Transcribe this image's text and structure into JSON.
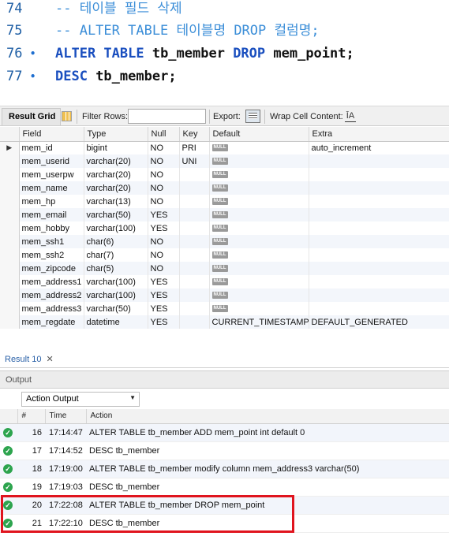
{
  "editor": {
    "lines": [
      {
        "number": "74",
        "dot": "",
        "segments": [
          {
            "cls": "cm",
            "text": "-- 테이블 필드 삭제"
          }
        ]
      },
      {
        "number": "75",
        "dot": "",
        "segments": [
          {
            "cls": "cm",
            "text": "-- ALTER TABLE 테이블명 DROP 컬럼명;"
          }
        ]
      },
      {
        "number": "76",
        "dot": "•",
        "segments": [
          {
            "cls": "kw",
            "text": "ALTER TABLE "
          },
          {
            "cls": "id",
            "text": "tb_member "
          },
          {
            "cls": "kw",
            "text": "DROP "
          },
          {
            "cls": "id",
            "text": "mem_point"
          },
          {
            "cls": "plain",
            "text": ";"
          }
        ]
      },
      {
        "number": "77",
        "dot": "•",
        "segments": [
          {
            "cls": "kw",
            "text": "DESC "
          },
          {
            "cls": "id",
            "text": "tb_member"
          },
          {
            "cls": "plain",
            "text": ";"
          }
        ]
      }
    ]
  },
  "grid_toolbar": {
    "tab_label": "Result Grid",
    "filter_label": "Filter Rows:",
    "export_label": "Export:",
    "wrap_label": "Wrap Cell Content:",
    "wrap_icon": "ĪA"
  },
  "result": {
    "row_marker": "▶",
    "null_text": "NULL",
    "columns": [
      "Field",
      "Type",
      "Null",
      "Key",
      "Default",
      "Extra"
    ],
    "rows": [
      [
        "mem_id",
        "bigint",
        "NO",
        "PRI",
        "NULL",
        "auto_increment"
      ],
      [
        "mem_userid",
        "varchar(20)",
        "NO",
        "UNI",
        "NULL",
        ""
      ],
      [
        "mem_userpw",
        "varchar(20)",
        "NO",
        "",
        "NULL",
        ""
      ],
      [
        "mem_name",
        "varchar(20)",
        "NO",
        "",
        "NULL",
        ""
      ],
      [
        "mem_hp",
        "varchar(13)",
        "NO",
        "",
        "NULL",
        ""
      ],
      [
        "mem_email",
        "varchar(50)",
        "YES",
        "",
        "NULL",
        ""
      ],
      [
        "mem_hobby",
        "varchar(100)",
        "YES",
        "",
        "NULL",
        ""
      ],
      [
        "mem_ssh1",
        "char(6)",
        "NO",
        "",
        "NULL",
        ""
      ],
      [
        "mem_ssh2",
        "char(7)",
        "NO",
        "",
        "NULL",
        ""
      ],
      [
        "mem_zipcode",
        "char(5)",
        "NO",
        "",
        "NULL",
        ""
      ],
      [
        "mem_address1",
        "varchar(100)",
        "YES",
        "",
        "NULL",
        ""
      ],
      [
        "mem_address2",
        "varchar(100)",
        "YES",
        "",
        "NULL",
        ""
      ],
      [
        "mem_address3",
        "varchar(50)",
        "YES",
        "",
        "NULL",
        ""
      ],
      [
        "mem_regdate",
        "datetime",
        "YES",
        "",
        "CURRENT_TIMESTAMP",
        "DEFAULT_GENERATED"
      ]
    ]
  },
  "result_tab": {
    "label": "Result 10",
    "close": "✕"
  },
  "output": {
    "title": "Output",
    "selector_value": "Action Output",
    "selector_arrow": "▼",
    "columns": [
      "#",
      "Time",
      "Action"
    ],
    "status_glyph": "✓",
    "rows": [
      {
        "num": "16",
        "time": "17:14:47",
        "action": "ALTER TABLE tb_member ADD mem_point int default 0"
      },
      {
        "num": "17",
        "time": "17:14:52",
        "action": "DESC tb_member"
      },
      {
        "num": "18",
        "time": "17:19:00",
        "action": "ALTER TABLE tb_member modify column mem_address3 varchar(50)"
      },
      {
        "num": "19",
        "time": "17:19:03",
        "action": "DESC tb_member"
      },
      {
        "num": "20",
        "time": "17:22:08",
        "action": "ALTER TABLE tb_member DROP mem_point"
      },
      {
        "num": "21",
        "time": "17:22:10",
        "action": "DESC tb_member"
      }
    ]
  },
  "colors": {
    "highlight": "#e0141e",
    "success": "#2da44e",
    "keyword": "#1a4fbf",
    "comment": "#3b8ed8"
  }
}
